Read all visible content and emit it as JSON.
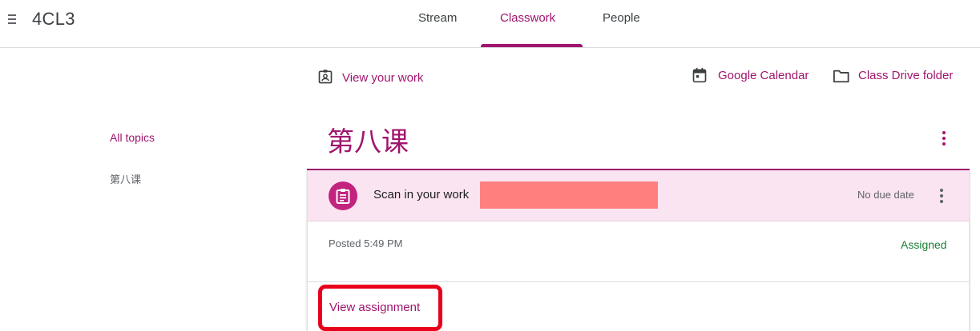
{
  "header": {
    "class_name": "4CL3",
    "tabs": [
      {
        "label": "Stream"
      },
      {
        "label": "Classwork"
      },
      {
        "label": "People"
      }
    ],
    "active_tab": "Classwork"
  },
  "actions": {
    "view_your_work": "View your work",
    "google_calendar": "Google Calendar",
    "class_drive_folder": "Class Drive folder"
  },
  "sidebar": {
    "topics": [
      {
        "label": "All topics"
      },
      {
        "label": "第八课"
      }
    ]
  },
  "topic": {
    "title": "第八课"
  },
  "assignment": {
    "title": "Scan in your work",
    "due": "No due date",
    "posted": "Posted 5:49 PM",
    "status": "Assigned",
    "view_label": "View assignment"
  },
  "colors": {
    "accent": "#a0156e",
    "assignment_icon_bg": "#c1237f",
    "card_header_bg": "#fbe4f1",
    "status_green": "#188038",
    "redaction": "#ff7f7f",
    "highlight": "#e8001a"
  },
  "icons": {
    "menu": "menu-icon",
    "view_work": "assignment-ind-icon",
    "calendar": "calendar-icon",
    "drive": "folder-icon",
    "assignment": "assignment-icon",
    "more": "more-vert-icon"
  }
}
